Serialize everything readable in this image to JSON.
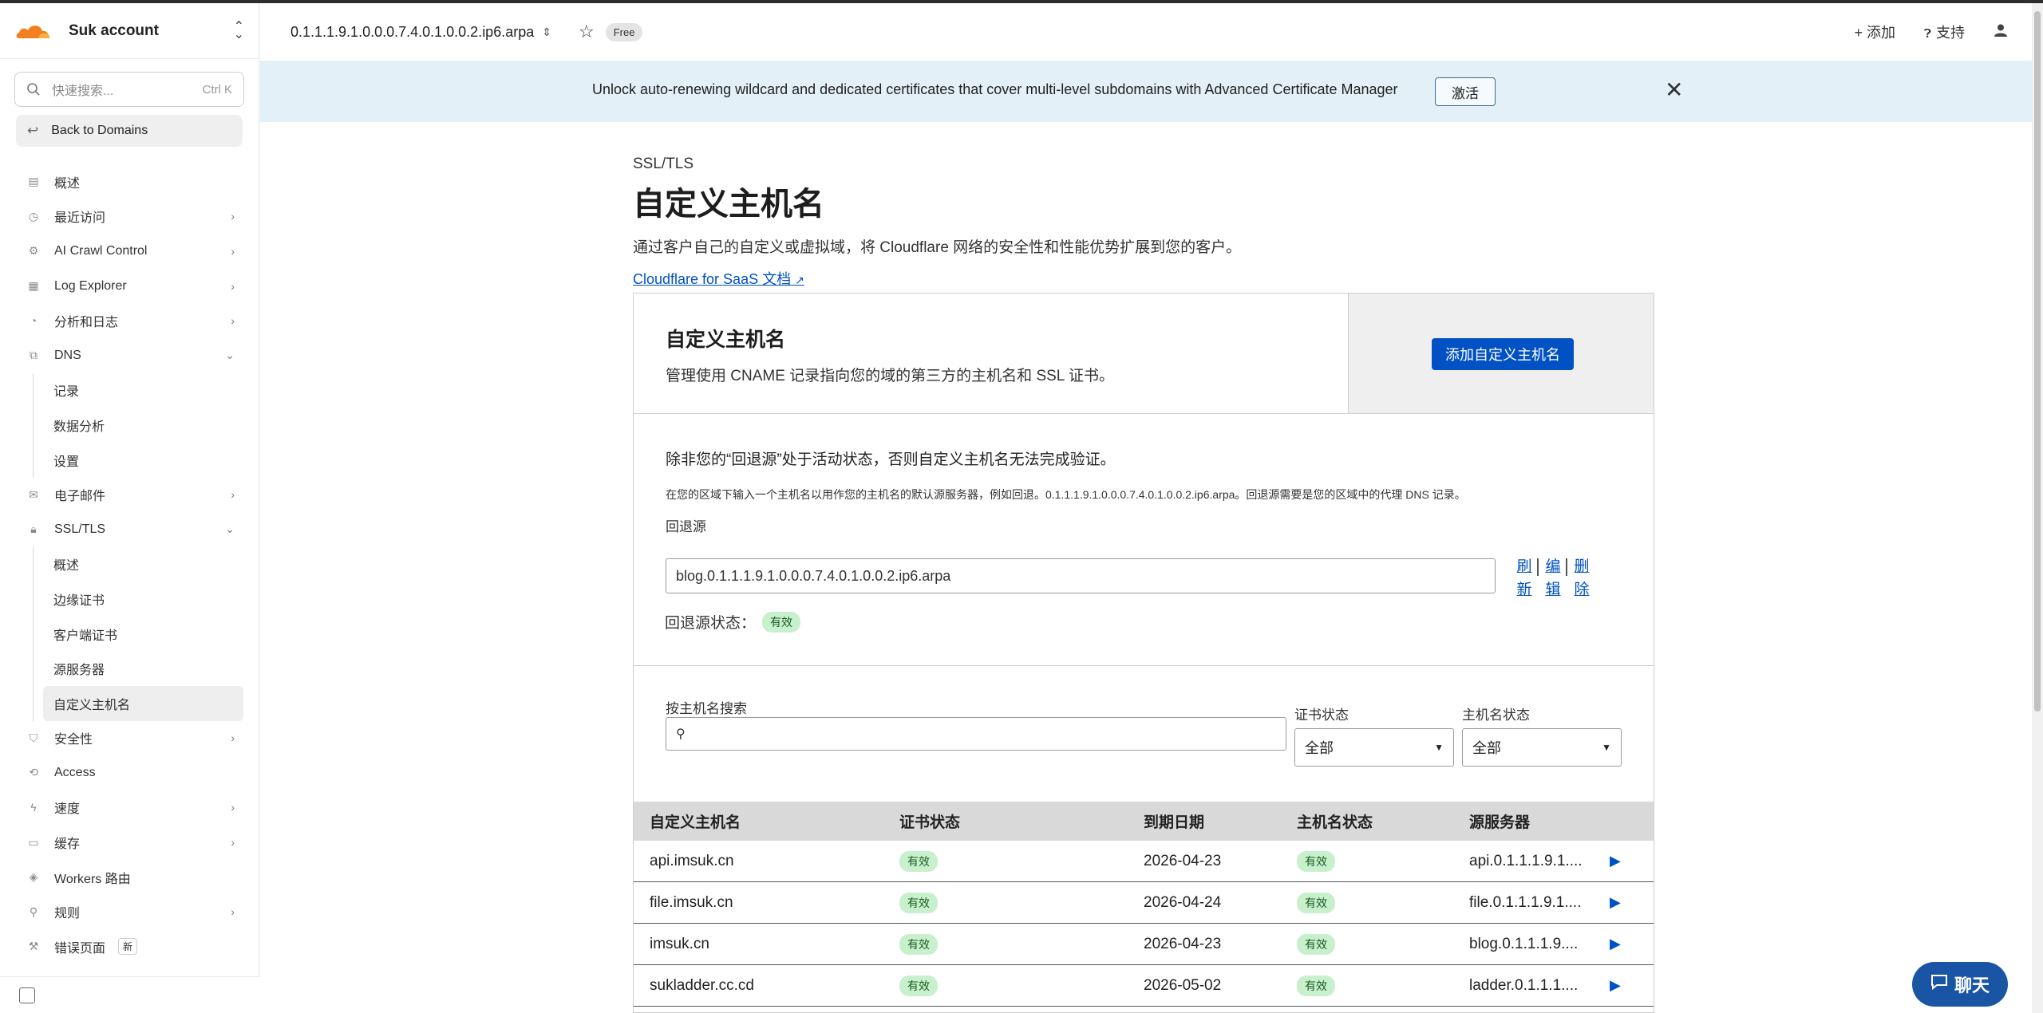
{
  "sidebar": {
    "account_name": "Suk account",
    "search_placeholder": "快速搜索...",
    "search_shortcut": "Ctrl K",
    "back_label": "Back to Domains",
    "items": [
      {
        "label": "概述",
        "icon": "doc-icon"
      },
      {
        "label": "最近访问",
        "icon": "clock-icon"
      },
      {
        "label": "AI Crawl Control",
        "icon": "ai-icon"
      },
      {
        "label": "Log Explorer",
        "icon": "log-icon"
      },
      {
        "label": "分析和日志",
        "icon": "chart-icon"
      },
      {
        "label": "DNS",
        "icon": "network-icon",
        "sub": [
          "记录",
          "数据分析",
          "设置"
        ]
      },
      {
        "label": "电子邮件",
        "icon": "mail-icon"
      },
      {
        "label": "SSL/TLS",
        "icon": "lock-icon",
        "sub": [
          "概述",
          "边缘证书",
          "客户端证书",
          "源服务器",
          "自定义主机名"
        ]
      },
      {
        "label": "安全性",
        "icon": "shield-icon"
      },
      {
        "label": "Access",
        "icon": "access-icon"
      },
      {
        "label": "速度",
        "icon": "bolt-icon"
      },
      {
        "label": "缓存",
        "icon": "cache-icon"
      },
      {
        "label": "Workers 路由",
        "icon": "workers-icon"
      },
      {
        "label": "规则",
        "icon": "rules-icon"
      },
      {
        "label": "错误页面",
        "icon": "wrench-icon",
        "badge": "新"
      }
    ]
  },
  "header": {
    "domain": "0.1.1.1.9.1.0.0.0.7.4.0.1.0.0.2.ip6.arpa",
    "plan": "Free",
    "add_label": "+ 添加",
    "support_label": "支持"
  },
  "banner": {
    "text": "Unlock auto-renewing wildcard and dedicated certificates that cover multi-level subdomains with Advanced Certificate Manager",
    "button": "激活"
  },
  "page": {
    "breadcrumb": "SSL/TLS",
    "title": "自定义主机名",
    "description": "通过客户自己的自定义或虚拟域，将 Cloudflare 网络的安全性和性能优势扩展到您的客户。",
    "doc_link": "Cloudflare for SaaS 文档"
  },
  "card": {
    "title": "自定义主机名",
    "subtitle": "管理使用 CNAME 记录指向您的域的第三方的主机名和 SSL 证书。",
    "add_button": "添加自定义主机名"
  },
  "fallback": {
    "warning": "除非您的“回退源”处于活动状态，否则自定义主机名无法完成验证。",
    "note": "在您的区域下输入一个主机名以用作您的主机名的默认源服务器，例如回退。0.1.1.1.9.1.0.0.0.7.4.0.1.0.0.2.ip6.arpa。回退源需要是您的区域中的代理 DNS 记录。",
    "label": "回退源",
    "value": "blog.0.1.1.1.9.1.0.0.0.7.4.0.1.0.0.2.ip6.arpa",
    "actions": [
      "刷新",
      "编辑",
      "删除"
    ],
    "status_label": "回退源状态：",
    "status_value": "有效"
  },
  "filters": {
    "search_label": "按主机名搜索",
    "cert_label": "证书状态",
    "cert_value": "全部",
    "host_label": "主机名状态",
    "host_value": "全部"
  },
  "table": {
    "headers": [
      "自定义主机名",
      "证书状态",
      "到期日期",
      "主机名状态",
      "源服务器"
    ],
    "rows": [
      {
        "host": "api.imsuk.cn",
        "cert": "有效",
        "expiry": "2026-04-23",
        "hstatus": "有效",
        "origin": "api.0.1.1.1.9.1...."
      },
      {
        "host": "file.imsuk.cn",
        "cert": "有效",
        "expiry": "2026-04-24",
        "hstatus": "有效",
        "origin": "file.0.1.1.1.9.1...."
      },
      {
        "host": "imsuk.cn",
        "cert": "有效",
        "expiry": "2026-04-23",
        "hstatus": "有效",
        "origin": "blog.0.1.1.1.9...."
      },
      {
        "host": "sukladder.cc.cd",
        "cert": "有效",
        "expiry": "2026-05-02",
        "hstatus": "有效",
        "origin": "ladder.0.1.1.1...."
      }
    ]
  },
  "chat": {
    "label": "聊天"
  },
  "colors": {
    "accent": "#0051c3",
    "banner_bg": "#e3f0f7",
    "pill_bg": "#c8f0cc",
    "chat_bg": "#1a55a5",
    "logo": "#f38020"
  }
}
